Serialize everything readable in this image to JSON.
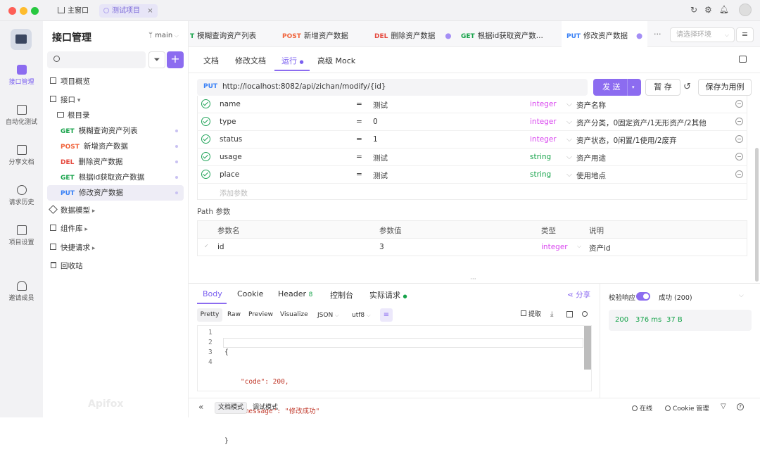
{
  "titlebar": {
    "home_label": "主窗口",
    "project_tab": "测试项目"
  },
  "rail": [
    {
      "label": "接口管理"
    },
    {
      "label": "自动化测试"
    },
    {
      "label": "分享文档"
    },
    {
      "label": "请求历史"
    },
    {
      "label": "项目设置"
    },
    {
      "label": "邀请成员"
    }
  ],
  "sidebar": {
    "title": "接口管理",
    "branch": "main",
    "search_placeholder": "",
    "items": [
      {
        "label": "项目概览"
      },
      {
        "label": "接口"
      },
      {
        "label": "根目录"
      }
    ],
    "endpoints": [
      {
        "method": "GET",
        "label": "模糊查询资产列表"
      },
      {
        "method": "POST",
        "label": "新增资产数据"
      },
      {
        "method": "DEL",
        "label": "删除资产数据"
      },
      {
        "method": "GET",
        "label": "根据id获取资产数据"
      },
      {
        "method": "PUT",
        "label": "修改资产数据"
      }
    ],
    "footer_items": [
      {
        "label": "数据模型"
      },
      {
        "label": "组件库"
      },
      {
        "label": "快捷请求"
      },
      {
        "label": "回收站"
      }
    ],
    "watermark": "Apifox"
  },
  "file_tabs": [
    {
      "method": "T",
      "label": "模糊查询资产列表"
    },
    {
      "method": "POST",
      "label": "新增资产数据"
    },
    {
      "method": "DEL",
      "label": "删除资产数据"
    },
    {
      "method": "GET",
      "label": "根据id获取资产数..."
    },
    {
      "method": "PUT",
      "label": "修改资产数据"
    }
  ],
  "env_placeholder": "请选择环境",
  "sub_tabs": [
    "文档",
    "修改文档",
    "运行",
    "高级 Mock"
  ],
  "request": {
    "method": "PUT",
    "url": "http://localhost:8082/api/zichan/modify/{id}",
    "send": "发 送",
    "save_temp": "暂 存",
    "save_case": "保存为用例"
  },
  "params": [
    {
      "name": "name",
      "eq": "=",
      "value": "测试",
      "type": "integer",
      "desc": "资产名称"
    },
    {
      "name": "type",
      "eq": "=",
      "value": "0",
      "type": "integer",
      "desc": "资产分类，0固定资产/1无形资产/2其他"
    },
    {
      "name": "status",
      "eq": "=",
      "value": "1",
      "type": "integer",
      "desc": "资产状态，0闲置/1使用/2废弃"
    },
    {
      "name": "usage",
      "eq": "=",
      "value": "测试",
      "type": "string",
      "desc": "资产用途"
    },
    {
      "name": "place",
      "eq": "=",
      "value": "测试",
      "type": "string",
      "desc": "使用地点"
    }
  ],
  "add_param": "添加参数",
  "path_section": {
    "title": "Path 参数",
    "headers": [
      "参数名",
      "参数值",
      "类型",
      "说明"
    ],
    "row": {
      "name": "id",
      "value": "3",
      "type": "integer",
      "desc": "资产id"
    }
  },
  "response": {
    "tabs": [
      "Body",
      "Cookie",
      "Header",
      "控制台",
      "实际请求"
    ],
    "header_count": "8",
    "share": "分享",
    "formats": [
      "Pretty",
      "Raw",
      "Preview",
      "Visualize"
    ],
    "json": "JSON",
    "encoding": "utf8",
    "extract": "提取",
    "lines": [
      "1",
      "2",
      "3",
      "4"
    ],
    "code": [
      "{",
      "    \"code\": 200,",
      "    \"message\": \"修改成功\"",
      "}"
    ],
    "validate": "校验响应",
    "result": "成功 (200)",
    "status": "200",
    "time": "376 ms",
    "size": "37 B"
  },
  "footer": {
    "doc_mode": "文档模式",
    "debug_mode": "调试模式",
    "online": "在线",
    "cookie": "Cookie 管理"
  },
  "colors": {
    "accent": "#8c6cf0",
    "get": "#17a34a",
    "post": "#f0643c",
    "del": "#e5483d",
    "put": "#3b82f6",
    "string_type": "#16a34a",
    "integer_type": "#d946ef"
  }
}
